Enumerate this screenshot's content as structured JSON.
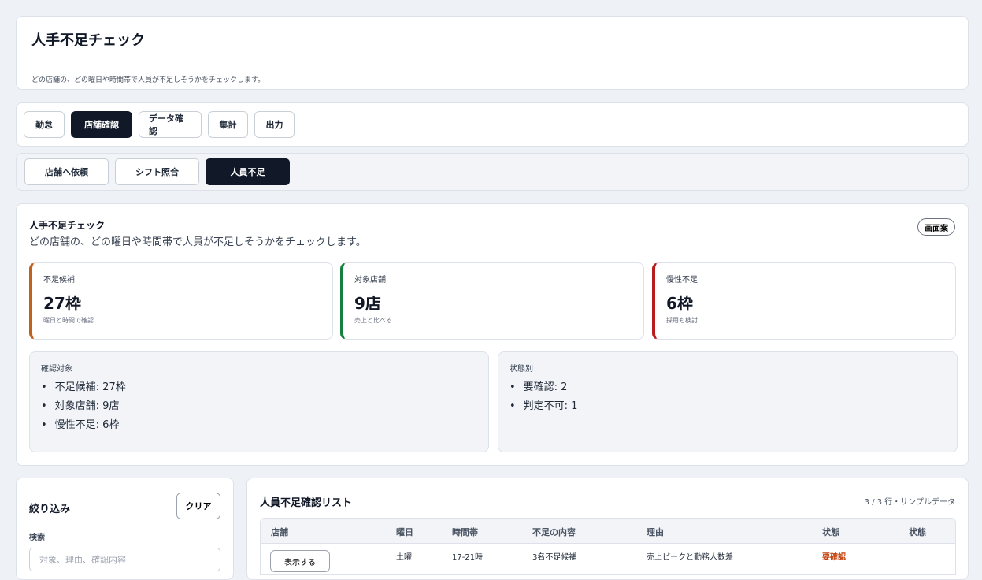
{
  "header": {
    "title": "人手不足チェック",
    "description": "どの店舗の、どの曜日や時間帯で人員が不足しそうかをチェックします。"
  },
  "main_tabs": [
    "勤怠",
    "店舗確認",
    "データ確認",
    "集計",
    "出力"
  ],
  "sub_tabs": [
    "店舗へ依頼",
    "シフト照合",
    "人員不足"
  ],
  "summary": {
    "title": "人手不足チェック",
    "description": "どの店舗の、どの曜日や時間帯で人員が不足しそうかをチェックします。",
    "mock_button": "画面案",
    "stats": [
      {
        "label": "不足候補",
        "value": "27枠",
        "sub": "曜日と時間で確認",
        "color": "#c2611b"
      },
      {
        "label": "対象店舗",
        "value": "9店",
        "sub": "売上と比べる",
        "color": "#15803d"
      },
      {
        "label": "慢性不足",
        "value": "6枠",
        "sub": "採用も検討",
        "color": "#b91c1c"
      }
    ],
    "targets": {
      "title": "確認対象",
      "items": [
        "不足候補: 27枠",
        "対象店舗: 9店",
        "慢性不足: 6枠"
      ]
    },
    "states": {
      "title": "状態別",
      "items": [
        "要確認: 2",
        "判定不可: 1"
      ]
    }
  },
  "filter": {
    "title": "絞り込み",
    "clear_label": "クリア",
    "search_label": "検索",
    "search_placeholder": "対象、理由、確認内容"
  },
  "list": {
    "title": "人員不足確認リスト",
    "count": "3 / 3 行・サンプルデータ",
    "columns": [
      "店舗",
      "曜日",
      "時間帯",
      "不足の内容",
      "理由",
      "状態",
      "状態"
    ],
    "rows": [
      {
        "store": "表示する",
        "day": "土曜",
        "time": "17-21時",
        "content": "3名不足候補",
        "reason": "売上ピークと勤務人数差",
        "status": "要確認"
      }
    ]
  }
}
